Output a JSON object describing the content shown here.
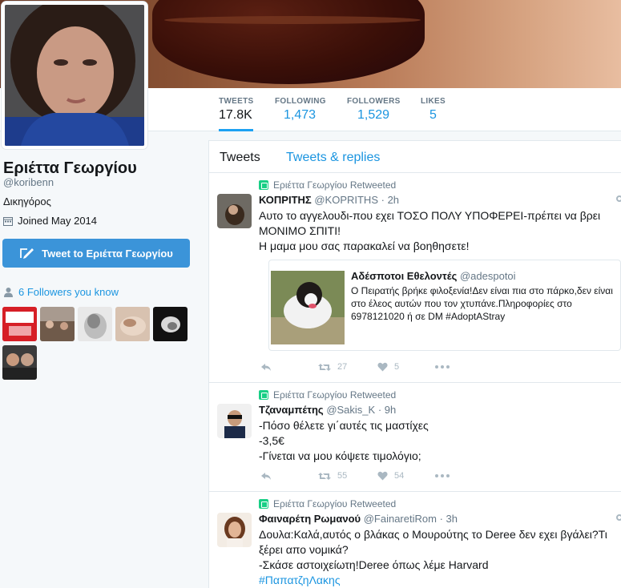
{
  "profile": {
    "name": "Εριέττα Γεωργίου",
    "handle": "@koribenn",
    "bio": "Δικηγόρος",
    "joined": "Joined May 2014",
    "tweet_to_label": "Tweet to Εριέττα Γεωργίου",
    "followers_you_know": "6 Followers you know"
  },
  "nav": {
    "tweets": {
      "label": "TWEETS",
      "value": "17.8K"
    },
    "following": {
      "label": "FOLLOWING",
      "value": "1,473"
    },
    "followers": {
      "label": "FOLLOWERS",
      "value": "1,529"
    },
    "likes": {
      "label": "LIKES",
      "value": "5"
    }
  },
  "tabs": {
    "tweets": "Tweets",
    "replies": "Tweets & replies"
  },
  "tweets": [
    {
      "retweeted_by": "Εριέττα Γεωργίου Retweeted",
      "name": "ΚΟΠΡΙΤΗΣ",
      "handle": "@KOPRITHS",
      "time": "· 2h",
      "lines": [
        "Αυτο το αγγελουδι-που εχει ΤΟΣΟ ΠΟΛΥ ΥΠΟΦΕΡΕΙ-πρέπει να βρει",
        "ΜΟΝΙΜΟ ΣΠΙΤΙ!",
        "Η μαμα μου σας παρακαλεί να βοηθησετε!"
      ],
      "quote": {
        "name": "Αδέσποτοι Εθελοντές",
        "handle": "@adespotoi",
        "text": "Ο Πειρατής βρήκε φιλοξενία!Δεν είναι πια στο πάρκο,δεν είναι στο έλεος αυτών που τον χτυπάνε.Πληροφορίες στο 6978121020 ή σε DM #AdoptAStray"
      },
      "retweets": "27",
      "likes": "5"
    },
    {
      "retweeted_by": "Εριέττα Γεωργίου Retweeted",
      "name": "Τζαναμπέτης",
      "handle": "@Sakis_K",
      "time": "· 9h",
      "lines": [
        "-Πόσο θέλετε γι΄αυτές τις μαστίχες",
        "-3,5€",
        "-Γίνεται να μου κόψετε τιμολόγιο;"
      ],
      "retweets": "55",
      "likes": "54"
    },
    {
      "retweeted_by": "Εριέττα Γεωργίου Retweeted",
      "name": "Φαιναρέτη Ρωμανού",
      "handle": "@FainaretiRom",
      "time": "· 3h",
      "lines": [
        "Δουλα:Καλά,αυτός ο βλάκας ο Μουρούτης το Deree δεν εχει βγάλει?Τι",
        "ξέρει απο νομικά?",
        "-Σκάσε αστοιχείωτη!Deree όπως λέμε Harvard"
      ],
      "hashtag": "#ΠαπατζηΛακης"
    }
  ]
}
